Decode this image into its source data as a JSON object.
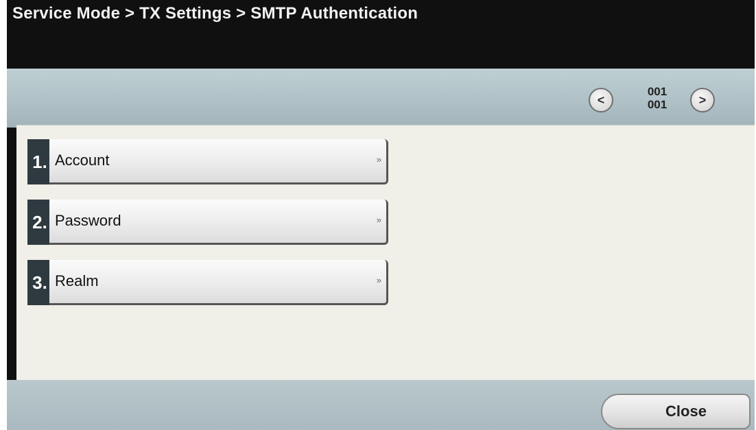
{
  "header": {
    "title": "Service Mode > TX Settings > SMTP Authentication"
  },
  "pager": {
    "prev_icon": "chevron-left-icon",
    "next_icon": "chevron-right-icon",
    "current_page": "001",
    "total_pages": "001"
  },
  "menu": {
    "items": [
      {
        "number": "1.",
        "label": "Account",
        "arrow": "»"
      },
      {
        "number": "2.",
        "label": "Password",
        "arrow": "»"
      },
      {
        "number": "3.",
        "label": "Realm",
        "arrow": "»"
      }
    ]
  },
  "footer": {
    "close_label": "Close"
  },
  "colors": {
    "toolbar": "#aebfc5",
    "panel": "#f0efe8",
    "number_badge": "#2f3a40"
  }
}
